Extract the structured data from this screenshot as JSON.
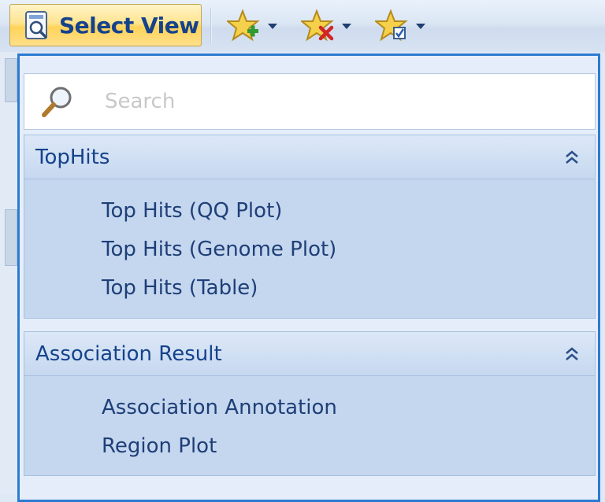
{
  "toolbar": {
    "select_view_label": "Select View",
    "select_view_icon": "view-selector-icon",
    "buttons": [
      {
        "icon": "add-favorite-icon"
      },
      {
        "icon": "remove-favorite-icon"
      },
      {
        "icon": "manage-favorites-icon"
      }
    ]
  },
  "search": {
    "placeholder": "Search",
    "value": ""
  },
  "groups": [
    {
      "title": "TopHits",
      "items": [
        "Top Hits (QQ Plot)",
        "Top Hits (Genome Plot)",
        "Top Hits (Table)"
      ]
    },
    {
      "title": "Association Result",
      "items": [
        "Association Annotation",
        "Region Plot"
      ]
    }
  ],
  "colors": {
    "accent_border": "#2c7bd1",
    "label_text": "#15428b",
    "button_highlight": "#ffd35a"
  }
}
